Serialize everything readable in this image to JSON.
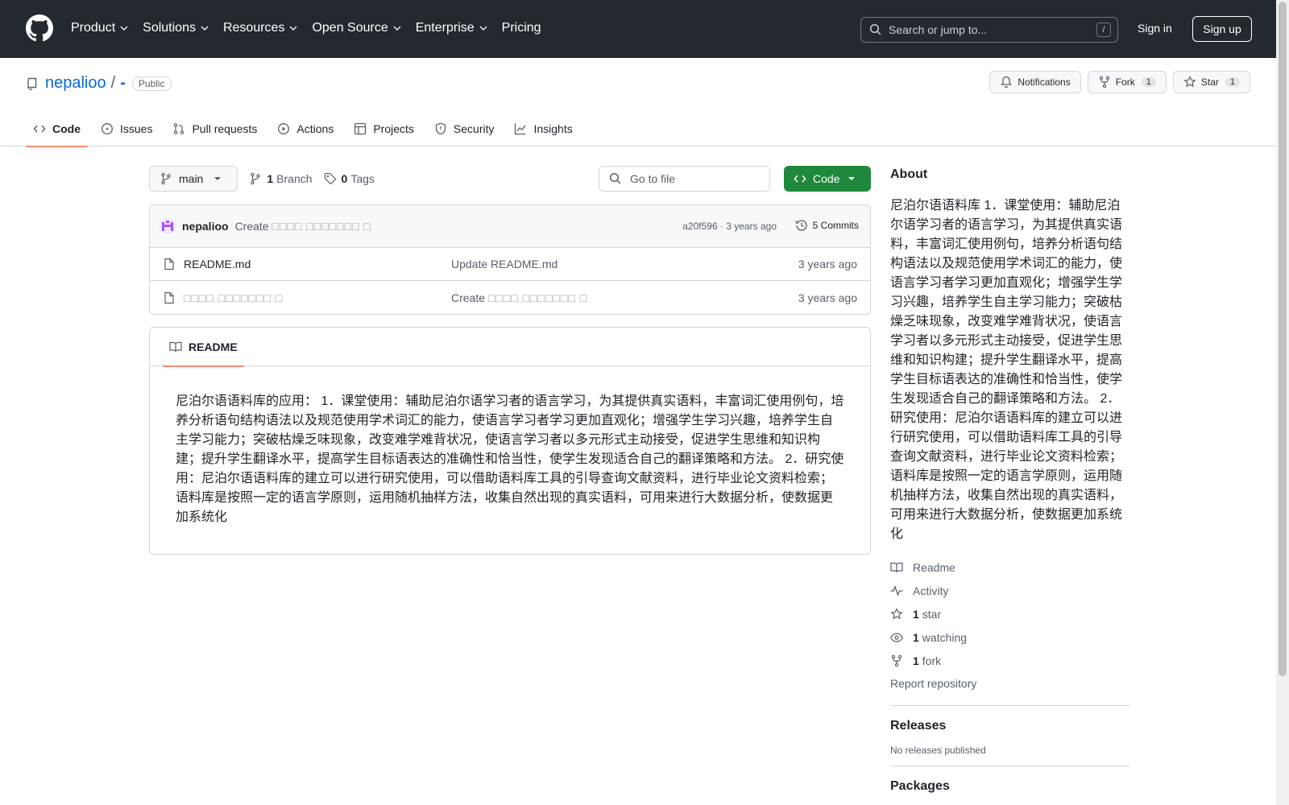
{
  "topnav": {
    "items": [
      "Product",
      "Solutions",
      "Resources",
      "Open Source",
      "Enterprise",
      "Pricing"
    ],
    "search_placeholder": "Search or jump to...",
    "search_key": "/",
    "signin": "Sign in",
    "signup": "Sign up"
  },
  "repo": {
    "owner": "nepalioo",
    "separator": "/",
    "name": "-",
    "visibility": "Public",
    "notifications": "Notifications",
    "fork_label": "Fork",
    "fork_count": "1",
    "star_label": "Star",
    "star_count": "1"
  },
  "tabs": [
    "Code",
    "Issues",
    "Pull requests",
    "Actions",
    "Projects",
    "Security",
    "Insights"
  ],
  "toolbar": {
    "branch": "main",
    "branch_count": "1",
    "branch_label": "Branch",
    "tag_count": "0",
    "tag_label": "Tags",
    "gofile_placeholder": "Go to file",
    "code_button": "Code"
  },
  "commit": {
    "author": "nepalioo",
    "message_prefix": "Create",
    "message_glyphs": "□□□□ □□□□□□□ □",
    "hash_age": "a20f596 · 3 years ago",
    "commits": "5 Commits"
  },
  "files": [
    {
      "name": "README.md",
      "name_glyphs": "",
      "msg_prefix": "Update README.md",
      "msg_glyphs": "",
      "age": "3 years ago"
    },
    {
      "name": "",
      "name_glyphs": "□□□□ □□□□□□□ □",
      "msg_prefix": "Create",
      "msg_glyphs": "□□□□ □□□□□□□ □",
      "age": "3 years ago"
    }
  ],
  "readme": {
    "tab": "README",
    "body": "尼泊尔语语料库的应用： 1．课堂使用：辅助尼泊尔语学习者的语言学习，为其提供真实语料，丰富词汇使用例句，培养分析语句结构语法以及规范使用学术词汇的能力，使语言学习者学习更加直观化；增强学生学习兴趣，培养学生自主学习能力；突破枯燥乏味现象，改变难学难背状况，使语言学习者以多元形式主动接受，促进学生思维和知识构建；提升学生翻译水平，提高学生目标语表达的准确性和恰当性，使学生发现适合自己的翻译策略和方法。 2．研究使用：尼泊尔语语料库的建立可以进行研究使用，可以借助语料库工具的引导查询文献资料，进行毕业论文资料检索；语料库是按照一定的语言学原则，运用随机抽样方法，收集自然出现的真实语料，可用来进行大数据分析，使数据更加系统化"
  },
  "about": {
    "heading": "About",
    "text": "尼泊尔语语料库 1．课堂使用：辅助尼泊尔语学习者的语言学习，为其提供真实语料，丰富词汇使用例句，培养分析语句结构语法以及规范使用学术词汇的能力，使语言学习者学习更加直观化；增强学生学习兴趣，培养学生自主学习能力；突破枯燥乏味现象，改变难学难背状况，使语言学习者以多元形式主动接受，促进学生思维和知识构建；提升学生翻译水平，提高学生目标语表达的准确性和恰当性，使学生发现适合自己的翻译策略和方法。 2．研究使用：尼泊尔语语料库的建立可以进行研究使用，可以借助语料库工具的引导查询文献资料，进行毕业论文资料检索；语料库是按照一定的语言学原则，运用随机抽样方法，收集自然出现的真实语料，可用来进行大数据分析，使数据更加系统化",
    "readme": "Readme",
    "activity": "Activity",
    "stars_count": "1",
    "stars_label": "star",
    "watching_count": "1",
    "watching_label": "watching",
    "forks_count": "1",
    "forks_label": "fork",
    "report": "Report repository",
    "releases_heading": "Releases",
    "releases_text": "No releases published",
    "packages_heading": "Packages"
  },
  "colors": {
    "header_bg": "#24292f",
    "link": "#0969da",
    "green_button": "#1f883d",
    "active_underline": "#fd8c73"
  }
}
